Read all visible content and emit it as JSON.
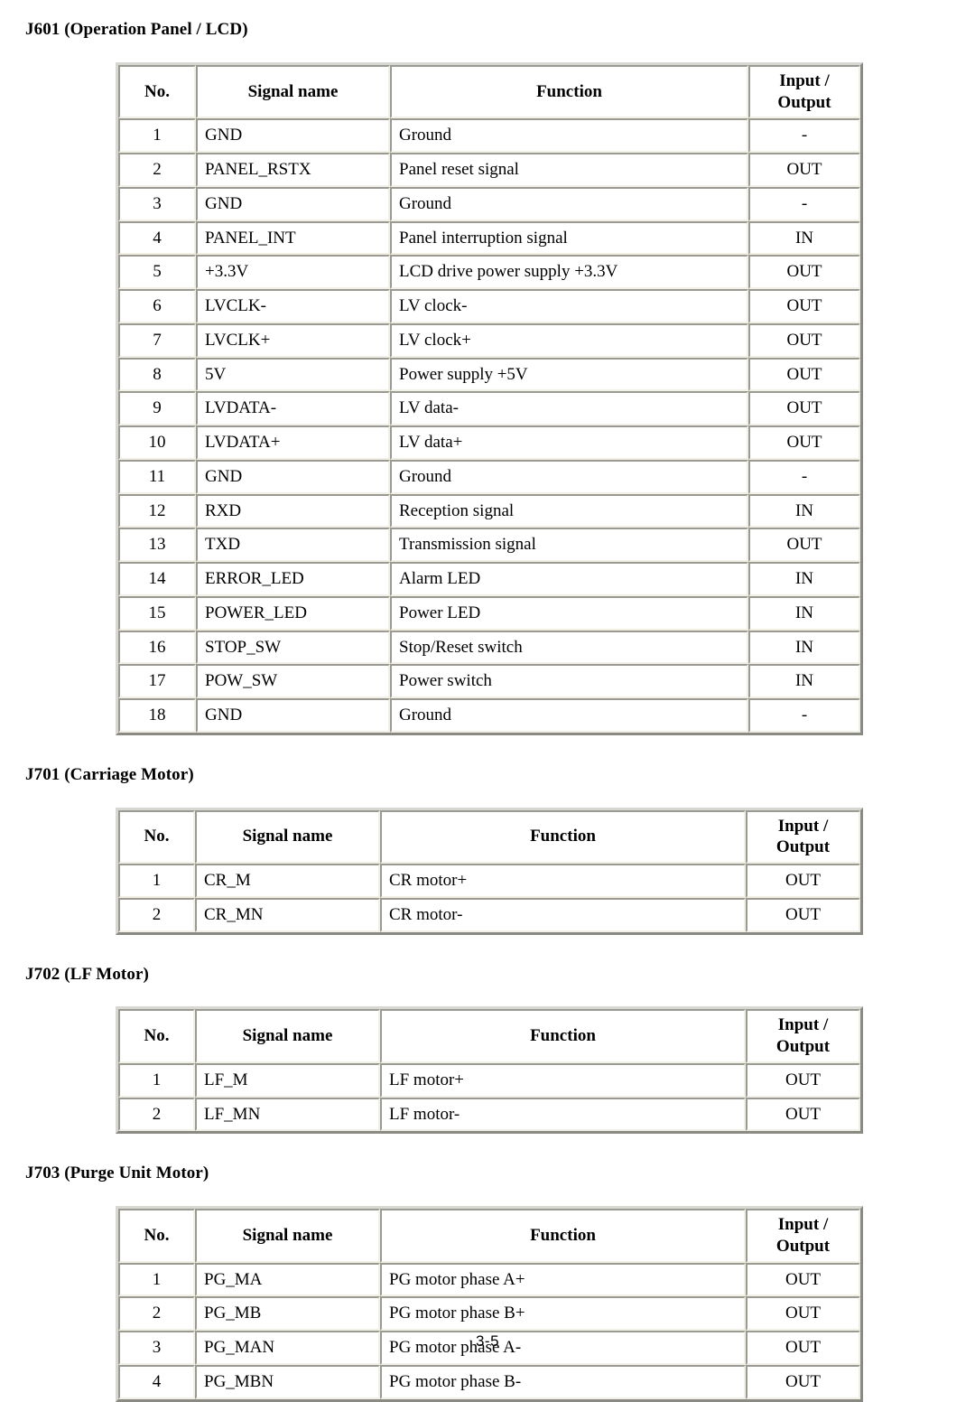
{
  "document": {
    "page_number": "3-5"
  },
  "columns": {
    "no": "No.",
    "signal_name": "Signal name",
    "function": "Function",
    "io_line1": "Input /",
    "io_line2": "Output"
  },
  "sections": [
    {
      "heading": "J601 (Operation Panel / LCD)",
      "rows": [
        {
          "no": "1",
          "signal": "GND",
          "function": "Ground",
          "io": "-"
        },
        {
          "no": "2",
          "signal": "PANEL_RSTX",
          "function": "Panel reset signal",
          "io": "OUT"
        },
        {
          "no": "3",
          "signal": "GND",
          "function": "Ground",
          "io": "-"
        },
        {
          "no": "4",
          "signal": "PANEL_INT",
          "function": "Panel interruption signal",
          "io": "IN"
        },
        {
          "no": "5",
          "signal": "+3.3V",
          "function": "LCD drive power supply +3.3V",
          "io": "OUT"
        },
        {
          "no": "6",
          "signal": "LVCLK-",
          "function": "LV clock-",
          "io": "OUT"
        },
        {
          "no": "7",
          "signal": "LVCLK+",
          "function": "LV clock+",
          "io": "OUT"
        },
        {
          "no": "8",
          "signal": "5V",
          "function": "Power supply +5V",
          "io": "OUT"
        },
        {
          "no": "9",
          "signal": "LVDATA-",
          "function": "LV data-",
          "io": "OUT"
        },
        {
          "no": "10",
          "signal": "LVDATA+",
          "function": "LV data+",
          "io": "OUT"
        },
        {
          "no": "11",
          "signal": "GND",
          "function": "Ground",
          "io": "-"
        },
        {
          "no": "12",
          "signal": "RXD",
          "function": "Reception signal",
          "io": "IN"
        },
        {
          "no": "13",
          "signal": "TXD",
          "function": "Transmission signal",
          "io": "OUT"
        },
        {
          "no": "14",
          "signal": "ERROR_LED",
          "function": "Alarm LED",
          "io": "IN"
        },
        {
          "no": "15",
          "signal": "POWER_LED",
          "function": "Power LED",
          "io": "IN"
        },
        {
          "no": "16",
          "signal": "STOP_SW",
          "function": "Stop/Reset switch",
          "io": "IN"
        },
        {
          "no": "17",
          "signal": "POW_SW",
          "function": "Power switch",
          "io": "IN"
        },
        {
          "no": "18",
          "signal": "GND",
          "function": "Ground",
          "io": "-"
        }
      ]
    },
    {
      "heading": "J701 (Carriage Motor)",
      "rows": [
        {
          "no": "1",
          "signal": "CR_M",
          "function": "CR motor+",
          "io": "OUT"
        },
        {
          "no": "2",
          "signal": "CR_MN",
          "function": "CR motor-",
          "io": "OUT"
        }
      ]
    },
    {
      "heading": "J702 (LF Motor)",
      "rows": [
        {
          "no": "1",
          "signal": "LF_M",
          "function": "LF motor+",
          "io": "OUT"
        },
        {
          "no": "2",
          "signal": "LF_MN",
          "function": "LF motor-",
          "io": "OUT"
        }
      ]
    },
    {
      "heading": "J703 (Purge Unit Motor)",
      "rows": [
        {
          "no": "1",
          "signal": "PG_MA",
          "function": "PG motor phase A+",
          "io": "OUT"
        },
        {
          "no": "2",
          "signal": "PG_MB",
          "function": "PG motor phase B+",
          "io": "OUT"
        },
        {
          "no": "3",
          "signal": "PG_MAN",
          "function": "PG motor phase A-",
          "io": "OUT"
        },
        {
          "no": "4",
          "signal": "PG_MBN",
          "function": "PG motor phase B-",
          "io": "OUT"
        }
      ]
    }
  ]
}
